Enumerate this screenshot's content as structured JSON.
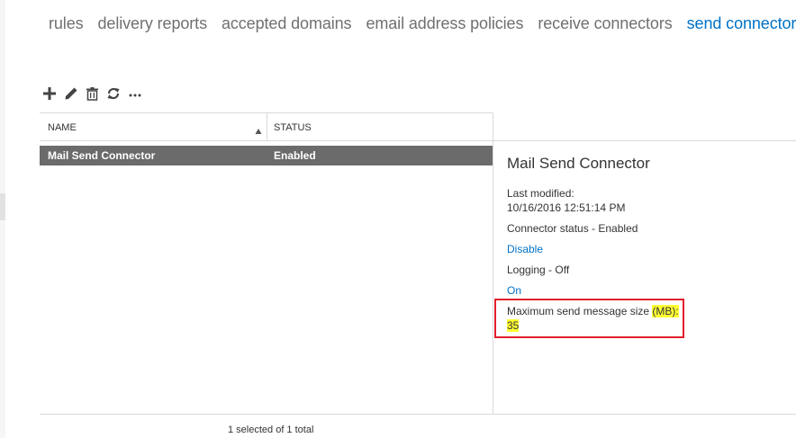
{
  "nav": {
    "tabs": [
      {
        "label": "rules",
        "active": false
      },
      {
        "label": "delivery reports",
        "active": false
      },
      {
        "label": "accepted domains",
        "active": false
      },
      {
        "label": "email address policies",
        "active": false
      },
      {
        "label": "receive connectors",
        "active": false
      },
      {
        "label": "send connectors",
        "active": true
      }
    ]
  },
  "toolbar": {
    "icons": [
      "add-icon",
      "edit-icon",
      "delete-icon",
      "refresh-icon",
      "more-icon"
    ]
  },
  "list": {
    "columns": {
      "name": "NAME",
      "status": "STATUS"
    },
    "sort": "ascending",
    "rows": [
      {
        "name": "Mail Send Connector",
        "status": "Enabled",
        "selected": true
      }
    ],
    "footer": "1 selected of 1 total"
  },
  "details": {
    "title": "Mail Send Connector",
    "last_modified_label": "Last modified:",
    "last_modified_value": "10/16/2016 12:51:14 PM",
    "connector_status": "Connector status - Enabled",
    "disable_link": "Disable",
    "logging": "Logging - Off",
    "on_link": "On",
    "max_size_label_prefix": "Maximum send message size",
    "max_size_unit": "(MB):",
    "max_size_value": "35"
  },
  "colors": {
    "accent": "#0072c6",
    "tab_inactive": "#707070",
    "selected_row": "#6b6b6b",
    "highlight": "#ffff33",
    "annotation_box": "#e2202c"
  }
}
